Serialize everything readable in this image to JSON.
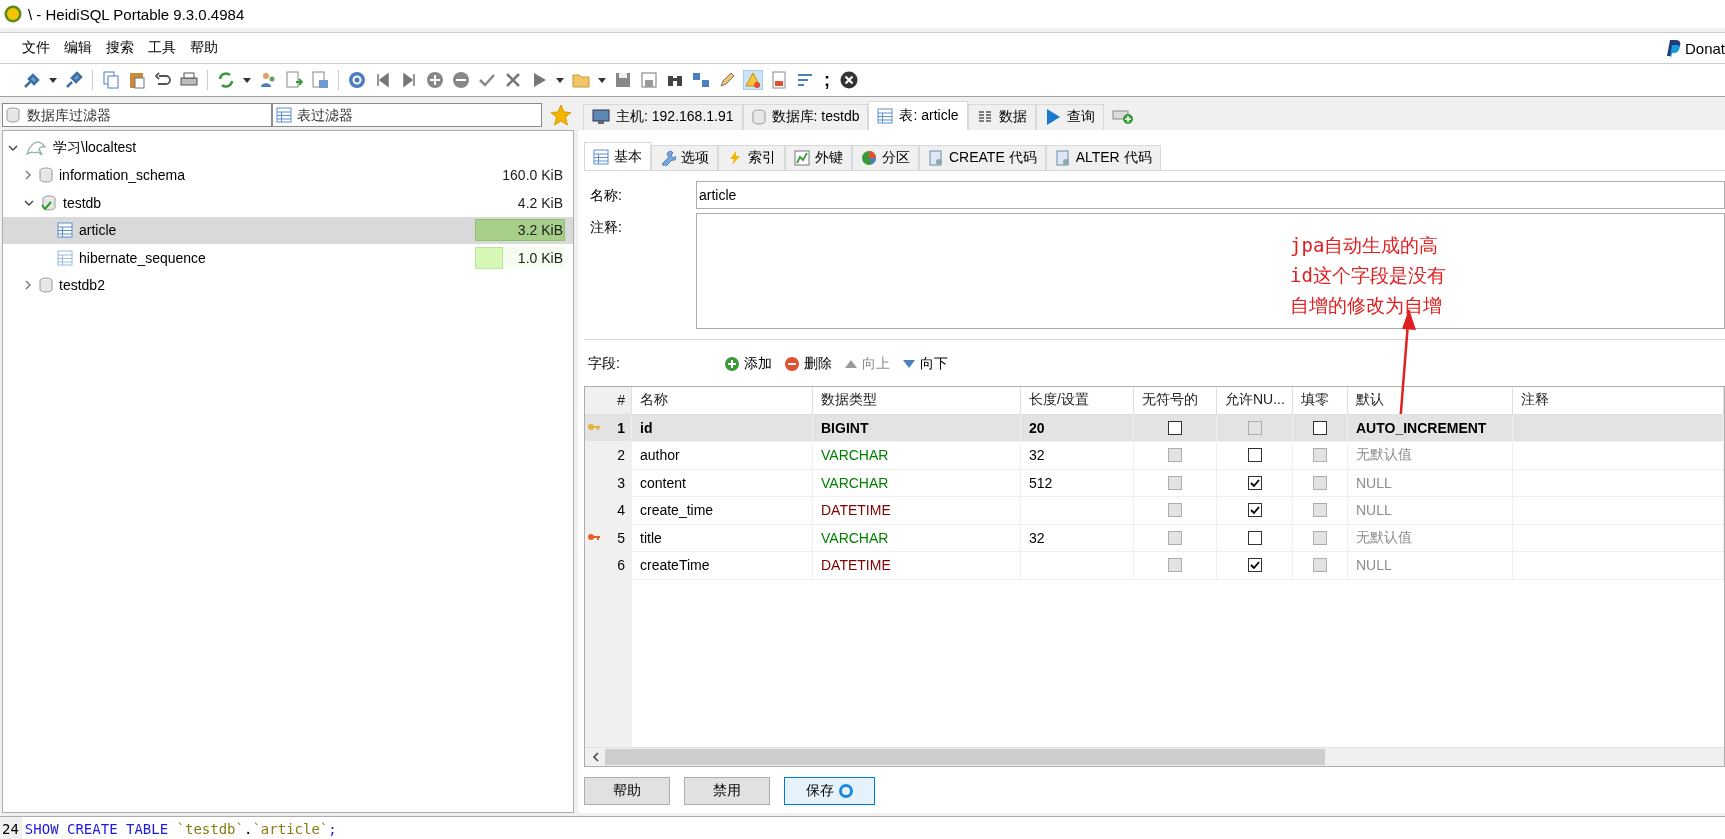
{
  "window": {
    "title": "\\ - HeidiSQL Portable 9.3.0.4984"
  },
  "menu": [
    "文件",
    "编辑",
    "搜索",
    "工具",
    "帮助"
  ],
  "donate": "Donat",
  "toolbar": {
    "semicolon_glyph": ";"
  },
  "filters": {
    "database_placeholder": "数据库过滤器",
    "table_placeholder": "表过滤器"
  },
  "tree": [
    {
      "kind": "server",
      "label": "学习\\localtest",
      "expanded": true,
      "selected": false,
      "children": [
        {
          "kind": "database",
          "label": "information_schema",
          "size": "160.0 KiB",
          "expanded": false,
          "in_use": false,
          "selected": false
        },
        {
          "kind": "database",
          "label": "testdb",
          "size": "4.2 KiB",
          "expanded": true,
          "in_use": true,
          "selected": false,
          "children": [
            {
              "kind": "table",
              "label": "article",
              "size": "3.2 KiB",
              "level": 1,
              "selected": true
            },
            {
              "kind": "table",
              "label": "hibernate_sequence",
              "size": "1.0 KiB",
              "level": 0.31,
              "selected": false
            }
          ]
        },
        {
          "kind": "database",
          "label": "testdb2",
          "expanded": false,
          "in_use": false,
          "selected": false
        }
      ]
    }
  ],
  "main_tabs": [
    {
      "label": "主机: 192.168.1.91",
      "selected": false
    },
    {
      "label": "数据库: testdb",
      "selected": false
    },
    {
      "label": "表: article",
      "selected": true
    },
    {
      "label": "数据",
      "selected": false
    },
    {
      "label": "查询",
      "selected": false
    }
  ],
  "sub_tabs": [
    {
      "label": "基本",
      "selected": true
    },
    {
      "label": "选项",
      "selected": false
    },
    {
      "label": "索引",
      "selected": false
    },
    {
      "label": "外键",
      "selected": false
    },
    {
      "label": "分区",
      "selected": false
    },
    {
      "label": "CREATE 代码",
      "selected": false
    },
    {
      "label": "ALTER 代码",
      "selected": false
    }
  ],
  "form": {
    "name_label": "名称:",
    "name_value": "article",
    "comment_label": "注释:"
  },
  "annotation": {
    "lines": [
      "jpa自动生成的高",
      "id这个字段是没有",
      "自增的修改为自增"
    ]
  },
  "fields_toolbar": {
    "label": "字段:",
    "actions": [
      {
        "label": "添加",
        "disabled": false
      },
      {
        "label": "删除",
        "disabled": false
      },
      {
        "label": "向上",
        "disabled": true
      },
      {
        "label": "向下",
        "disabled": false
      }
    ]
  },
  "columns": [
    "#",
    "名称",
    "数据类型",
    "长度/设置",
    "无符号的",
    "允许NU...",
    "填零",
    "默认",
    "注释"
  ],
  "rows": [
    {
      "num": "1",
      "name": "id",
      "type": "BIGINT",
      "color": "#000000",
      "length": "20",
      "kind": "primary_key",
      "selected": true,
      "unsigned": {
        "checked": false,
        "disabled": false
      },
      "allow_null": {
        "checked": false,
        "disabled": true
      },
      "zerofill": {
        "checked": false,
        "disabled": false
      },
      "default": "AUTO_INCREMENT"
    },
    {
      "num": "2",
      "name": "author",
      "type": "VARCHAR",
      "color": "#008000",
      "length": "32",
      "kind": "plain",
      "selected": false,
      "unsigned": {
        "checked": false,
        "disabled": true
      },
      "allow_null": {
        "checked": false,
        "disabled": false
      },
      "zerofill": {
        "checked": false,
        "disabled": true
      },
      "default": "无默认值"
    },
    {
      "num": "3",
      "name": "content",
      "type": "VARCHAR",
      "color": "#008000",
      "length": "512",
      "kind": "plain",
      "selected": false,
      "unsigned": {
        "checked": false,
        "disabled": true
      },
      "allow_null": {
        "checked": true,
        "disabled": false
      },
      "zerofill": {
        "checked": false,
        "disabled": true
      },
      "default": "NULL"
    },
    {
      "num": "4",
      "name": "create_time",
      "type": "DATETIME",
      "color": "#800000",
      "kind": "plain",
      "selected": false,
      "unsigned": {
        "checked": false,
        "disabled": true
      },
      "allow_null": {
        "checked": true,
        "disabled": false
      },
      "zerofill": {
        "checked": false,
        "disabled": true
      },
      "default": "NULL"
    },
    {
      "num": "5",
      "name": "title",
      "type": "VARCHAR",
      "color": "#008000",
      "length": "32",
      "kind": "index_key",
      "selected": false,
      "unsigned": {
        "checked": false,
        "disabled": true
      },
      "allow_null": {
        "checked": false,
        "disabled": false
      },
      "zerofill": {
        "checked": false,
        "disabled": true
      },
      "default": "无默认值"
    },
    {
      "num": "6",
      "name": "createTime",
      "type": "DATETIME",
      "color": "#800000",
      "kind": "plain",
      "selected": false,
      "unsigned": {
        "checked": false,
        "disabled": true
      },
      "allow_null": {
        "checked": true,
        "disabled": false
      },
      "zerofill": {
        "checked": false,
        "disabled": true
      },
      "default": "NULL"
    }
  ],
  "buttons": [
    {
      "label": "帮助",
      "default": false
    },
    {
      "label": "禁用",
      "default": false
    },
    {
      "label": "保存",
      "default": true
    }
  ],
  "log": {
    "line_number": "24",
    "tokens": [
      {
        "text": "SHOW CREATE TABLE",
        "kind": "keyword"
      },
      {
        "text": "`testdb`",
        "kind": "identifier"
      },
      {
        "text": ".",
        "kind": "plain"
      },
      {
        "text": "`article`",
        "kind": "identifier"
      },
      {
        "text": ";",
        "kind": "keyword"
      }
    ]
  }
}
